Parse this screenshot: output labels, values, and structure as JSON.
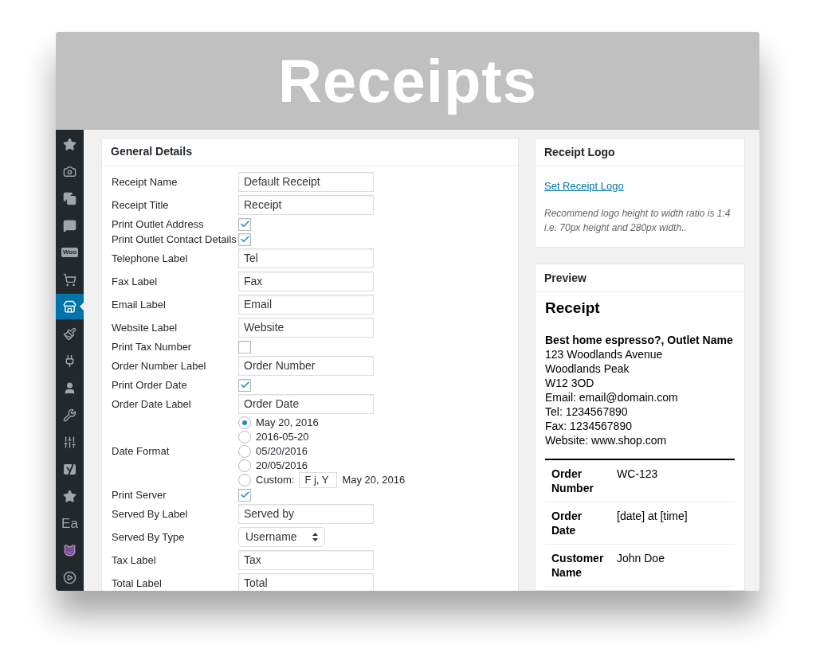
{
  "banner": {
    "title": "Receipts"
  },
  "sidebar": {
    "items": [
      {
        "kind": "star",
        "selected": false
      },
      {
        "kind": "media",
        "selected": false
      },
      {
        "kind": "pages",
        "selected": false
      },
      {
        "kind": "comments",
        "selected": false
      },
      {
        "kind": "woo",
        "label": "Woo",
        "selected": false
      },
      {
        "kind": "cart",
        "selected": false
      },
      {
        "kind": "store",
        "selected": true
      },
      {
        "kind": "brush",
        "selected": false
      },
      {
        "kind": "plug",
        "selected": false
      },
      {
        "kind": "user",
        "selected": false
      },
      {
        "kind": "wrench",
        "selected": false
      },
      {
        "kind": "sliders",
        "selected": false
      },
      {
        "kind": "yoast",
        "selected": false
      },
      {
        "kind": "star",
        "selected": false
      },
      {
        "kind": "text",
        "label": "Ea",
        "selected": false
      },
      {
        "kind": "cat",
        "selected": false
      },
      {
        "kind": "play",
        "selected": false
      }
    ]
  },
  "general_details": {
    "title": "General Details",
    "rows": [
      {
        "kind": "text",
        "label": "Receipt Name",
        "value": "Default Receipt"
      },
      {
        "kind": "text",
        "label": "Receipt Title",
        "value": "Receipt"
      },
      {
        "kind": "checkbox",
        "label": "Print Outlet Address",
        "checked": true
      },
      {
        "kind": "checkbox",
        "label": "Print Outlet Contact Details",
        "checked": true
      },
      {
        "kind": "text",
        "label": "Telephone Label",
        "value": "Tel"
      },
      {
        "kind": "text",
        "label": "Fax Label",
        "value": "Fax"
      },
      {
        "kind": "text",
        "label": "Email Label",
        "value": "Email"
      },
      {
        "kind": "text",
        "label": "Website Label",
        "value": "Website"
      },
      {
        "kind": "checkbox",
        "label": "Print Tax Number",
        "checked": false
      },
      {
        "kind": "text",
        "label": "Order Number Label",
        "value": "Order Number"
      },
      {
        "kind": "checkbox",
        "label": "Print Order Date",
        "checked": true
      },
      {
        "kind": "text",
        "label": "Order Date Label",
        "value": "Order Date"
      },
      {
        "kind": "radio",
        "label": "Date Format",
        "options": [
          {
            "label": "May 20, 2016",
            "selected": true
          },
          {
            "label": "2016-05-20",
            "selected": false
          },
          {
            "label": "05/20/2016",
            "selected": false
          },
          {
            "label": "20/05/2016",
            "selected": false
          },
          {
            "label": "Custom:",
            "selected": false,
            "value": "F j, Y",
            "example": "May 20, 2016"
          }
        ]
      },
      {
        "kind": "checkbox",
        "label": "Print Server",
        "checked": true
      },
      {
        "kind": "text",
        "label": "Served By Label",
        "value": "Served by"
      },
      {
        "kind": "select",
        "label": "Served By Type",
        "value": "Username"
      },
      {
        "kind": "text",
        "label": "Tax Label",
        "value": "Tax"
      },
      {
        "kind": "text",
        "label": "Total Label",
        "value": "Total"
      }
    ]
  },
  "receipt_logo": {
    "title": "Receipt Logo",
    "link": "Set Receipt Logo",
    "hint_lines": [
      "Recommend logo height to width ratio is 1:4",
      "i.e. 70px height and 280px width.."
    ]
  },
  "preview": {
    "title": "Preview",
    "receipt_title": "Receipt",
    "shop_name": "Best home espresso?, Outlet Name",
    "address_lines": [
      "123 Woodlands Avenue",
      "Woodlands Peak",
      "W12 3OD",
      "Email: email@domain.com",
      "Tel: 1234567890",
      "Fax: 1234567890",
      "Website: www.shop.com"
    ],
    "table": [
      {
        "label_lines": [
          "Order",
          "Number"
        ],
        "value": "WC-123"
      },
      {
        "label_lines": [
          "Order",
          "Date"
        ],
        "value": "[date] at [time]"
      },
      {
        "label_lines": [
          "Customer",
          "Name"
        ],
        "value": "John Doe"
      }
    ]
  }
}
